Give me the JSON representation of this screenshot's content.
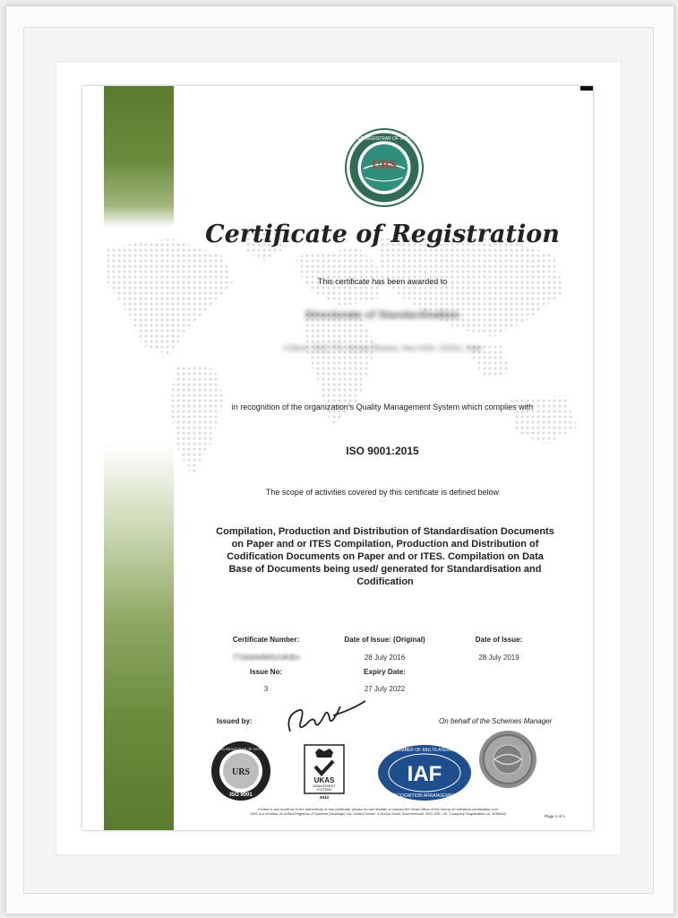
{
  "certificate": {
    "title": "Certificate of Registration",
    "awarded_line": "This certificate has been awarded to",
    "organization_name": "Directorate of Standardisation",
    "organization_address": "H Block, DHQ, P.O. Nirman Bhawan, New Delhi, 110011, India",
    "recognition_line": "in recognition of the organization's Quality Management System which complies with",
    "standard": "ISO 9001:2015",
    "scope_intro": "The scope of activities covered by this certificate is defined below",
    "scope_lines": [
      "Compilation, Production and Distribution of Standardisation Documents",
      "on Paper and or ITES Compilation, Production and Distribution of",
      "Codification Documents on Paper and or ITES. Compilation on Data",
      "Base of Documents being used/ generated for Standardisation and",
      "Codification"
    ],
    "details": {
      "certificate_number_label": "Certificate Number:",
      "certificate_number_value": "77163/A/0001/UK/En",
      "date_original_label": "Date of Issue: (Original)",
      "date_original_value": "28 July 2016",
      "date_issue_label": "Date of Issue:",
      "date_issue_value": "28 July 2019",
      "issue_no_label": "Issue No:",
      "issue_no_value": "3",
      "expiry_label": "Expiry Date:",
      "expiry_value": "27 July 2022"
    },
    "issued_by_label": "Issued by:",
    "behalf_label": "On behalf of the Schemes Manager",
    "footer_line1": "If there is any doubt as to the authenticity of this certificate, please do not hesitate to contact the Head Office of the Group on info@urs-certification.com",
    "footer_line2": "URS is a member of United Registrar of Systems (Holdings) Ltd, United House, 4 Horton Road, Bournemouth, BH1 2EE, UK. Company Registration no. 3288498",
    "page_label": "Page 1 of 1"
  },
  "logos": {
    "top_logo_text": "URS",
    "top_logo_ring_text": "UNITED REGISTRAR OF SYSTEMS",
    "bottom_urs_ring_text": "UNITED REGISTRAR OF SYSTEMS",
    "bottom_urs_text": "URS",
    "bottom_urs_iso": "ISO 9001",
    "ukas_name": "UKAS",
    "ukas_sub1": "MANAGEMENT",
    "ukas_sub2": "SYSTEMS",
    "ukas_code": "0043",
    "iaf_ring_top": "MEMBER OF MULTILATERAL",
    "iaf_ring_bottom": "RECOGNITION ARRANGEMENT",
    "iaf_text": "IAF"
  },
  "colors": {
    "green": "#5a7a2e",
    "urs_red": "#c0392b",
    "globe_teal": "#2f8f7a",
    "iaf_blue": "#1f4e8c"
  }
}
